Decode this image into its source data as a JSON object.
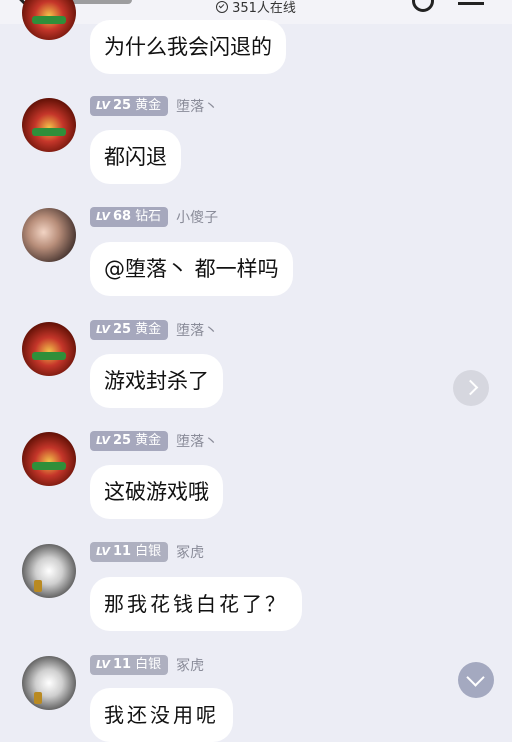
{
  "header": {
    "online_text": "351人在线"
  },
  "messages": [
    {
      "level": "LV",
      "level_num": "",
      "rank": "",
      "nick": "",
      "text": "为什么我会闪退的",
      "avatar": "gold-emblem-avatar"
    },
    {
      "level": "LV",
      "level_num": "25",
      "rank": "黄金",
      "nick": "堕落丶",
      "text": "都闪退",
      "avatar": "gold-emblem-avatar"
    },
    {
      "level": "LV",
      "level_num": "68",
      "rank": "钻石",
      "nick": "小傻子",
      "text": "@堕落丶 都一样吗",
      "avatar": "photo-avatar"
    },
    {
      "level": "LV",
      "level_num": "25",
      "rank": "黄金",
      "nick": "堕落丶",
      "text": "游戏封杀了",
      "avatar": "gold-emblem-avatar"
    },
    {
      "level": "LV",
      "level_num": "25",
      "rank": "黄金",
      "nick": "堕落丶",
      "text": "这破游戏哦",
      "avatar": "gold-emblem-avatar"
    },
    {
      "level": "LV",
      "level_num": "11",
      "rank": "白银",
      "nick": "冢虎",
      "text": "那我花钱白花了？",
      "avatar": "car-avatar"
    },
    {
      "level": "LV",
      "level_num": "11",
      "rank": "白银",
      "nick": "冢虎",
      "text": "我还没用呢",
      "avatar": "car-avatar"
    }
  ],
  "colors": {
    "background": "#ecedf5",
    "bubble": "#ffffff",
    "level_badge": "#a6a8bd",
    "nickname": "#8a8c99"
  }
}
